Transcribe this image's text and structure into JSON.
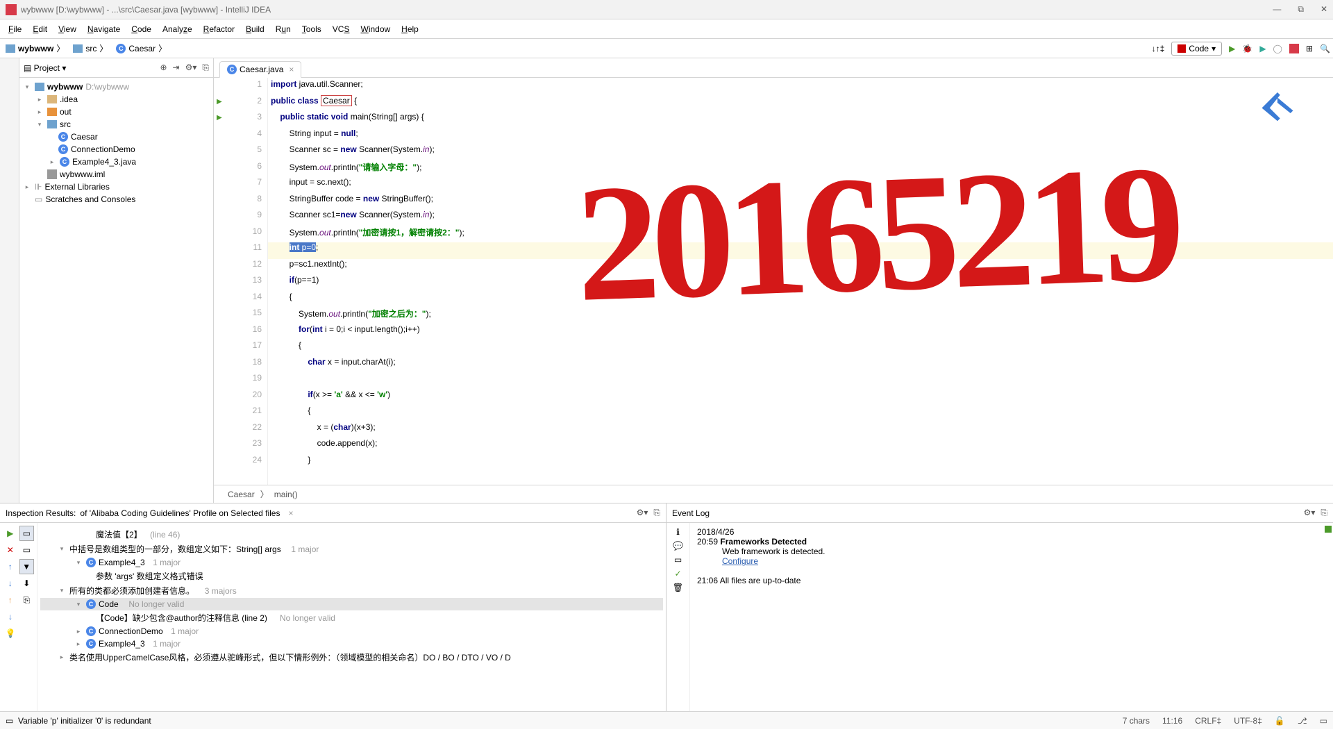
{
  "title": "wybwww [D:\\wybwww] - ...\\src\\Caesar.java [wybwww] - IntelliJ IDEA",
  "menu": [
    "File",
    "Edit",
    "View",
    "Navigate",
    "Code",
    "Analyze",
    "Refactor",
    "Build",
    "Run",
    "Tools",
    "VCS",
    "Window",
    "Help"
  ],
  "crumbs": {
    "root": "wybwww",
    "src": "src",
    "file": "Caesar"
  },
  "runConfig": "Code",
  "project": {
    "header": "Project",
    "root": {
      "name": "wybwww",
      "path": "D:\\wybwww"
    },
    "idea": ".idea",
    "out": "out",
    "src": "src",
    "files": [
      "Caesar",
      "ConnectionDemo",
      "Example4_3.java"
    ],
    "iml": "wybwww.iml",
    "ext": "External Libraries",
    "scratch": "Scratches and Consoles"
  },
  "tab": {
    "name": "Caesar.java"
  },
  "code": {
    "lines": [
      "import java.util.Scanner;",
      "public class Caesar {",
      "    public static void main(String[] args) {",
      "        String input = null;",
      "        Scanner sc = new Scanner(System.in);",
      "        System.out.println(\"请输入字母：\");",
      "        input = sc.next();",
      "        StringBuffer code = new StringBuffer();",
      "        Scanner sc1=new Scanner(System.in);",
      "        System.out.println(\"加密请按1，解密请按2：\");",
      "        int p=0;",
      "        p=sc1.nextInt();",
      "        if(p==1)",
      "        {",
      "            System.out.println(\"加密之后为：\");",
      "            for(int i = 0;i < input.length();i++)",
      "            {",
      "                char x = input.charAt(i);",
      "",
      "                if(x >= 'a' && x <= 'w')",
      "                {",
      "                    x = (char)(x+3);",
      "                    code.append(x);",
      "                }"
    ]
  },
  "crumbCode": {
    "cls": "Caesar",
    "method": "main()"
  },
  "inspection": {
    "header": "Inspection Results:",
    "profile": "of 'Alibaba Coding Guidelines' Profile on Selected files",
    "i0": {
      "t": "魔法值【2】",
      "s": "(line 46)"
    },
    "i1": {
      "t": "中括号是数组类型的一部分，数组定义如下：String[] args",
      "s": "1 major"
    },
    "i2": {
      "t": "Example4_3",
      "s": "1 major"
    },
    "i3": {
      "t": "参数 'args' 数组定义格式错误"
    },
    "i4": {
      "t": "所有的类都必须添加创建者信息。",
      "s": "3 majors"
    },
    "i5": {
      "t": "Code",
      "s": "No longer valid"
    },
    "i6": {
      "t": "【Code】缺少包含@author的注释信息 (line 2)",
      "s": "No longer valid"
    },
    "i7": {
      "t": "ConnectionDemo",
      "s": "1 major"
    },
    "i8": {
      "t": "Example4_3",
      "s": "1 major"
    },
    "i9": {
      "t": "类名使用UpperCamelCase风格，必须遵从驼峰形式，但以下情形例外：（领域模型的相关命名）DO / BO / DTO / VO / D"
    }
  },
  "eventlog": {
    "header": "Event Log",
    "date": "2018/4/26",
    "t1": "20:59",
    "e1": "Frameworks Detected",
    "e1b": "Web framework is detected.",
    "e1c": "Configure",
    "t2": "21:06",
    "e2": "All files are up-to-date"
  },
  "status": {
    "msg": "Variable 'p' initializer '0' is redundant",
    "chars": "7 chars",
    "pos": "11:16",
    "le": "CRLF‡",
    "enc": "UTF-8‡"
  },
  "annotation": "20165219"
}
